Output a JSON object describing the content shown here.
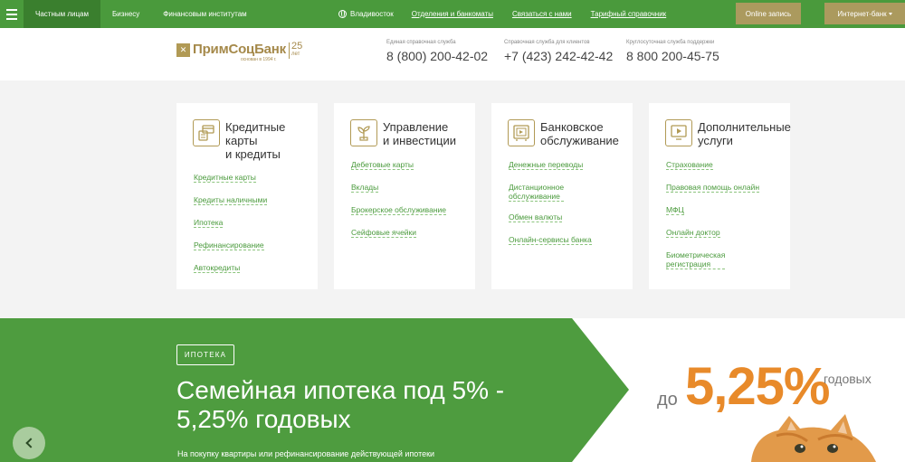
{
  "topbar": {
    "segments": [
      "Частным лицам",
      "Бизнесу",
      "Финансовым институтам"
    ],
    "city": "Владивосток",
    "links": [
      "Отделения и банкоматы",
      "Связаться с нами",
      "Тарифный справочник"
    ],
    "online_button": "Online запись",
    "bank_button": "Интернет-банк"
  },
  "header": {
    "logo": {
      "name": "ПримСоцБанк",
      "sub": "основан в 1994 г.",
      "years": "25",
      "years_word": "лет"
    },
    "phones": [
      {
        "caption": "Единая справочная служба",
        "number": "8 (800) 200-42-02"
      },
      {
        "caption": "Справочная служба для клиентов",
        "number": "+7 (423) 242-42-42"
      },
      {
        "caption": "Круглосуточная служба поддержки",
        "number": "8 800 200-45-75"
      }
    ]
  },
  "cards": [
    {
      "icon": "credit-card-icon",
      "title": [
        "Кредитные",
        "карты",
        "и кредиты"
      ],
      "links": [
        "Кредитные карты",
        "Кредиты наличными",
        "Ипотека",
        "Рефинансирование",
        "Автокредиты"
      ]
    },
    {
      "icon": "plant-icon",
      "title": [
        "Управление",
        "и инвестиции"
      ],
      "links": [
        "Дебетовые карты",
        "Вклады",
        "Брокерское обслуживание",
        "Сейфовые ячейки"
      ]
    },
    {
      "icon": "safe-icon",
      "title": [
        "Банковское",
        "обслуживание"
      ],
      "links": [
        [
          "Денежные переводы"
        ],
        [
          "Дистанционное",
          "обслуживание"
        ],
        [
          "Обмен валюты"
        ],
        [
          "Онлайн-сервисы банка"
        ]
      ]
    },
    {
      "icon": "monitor-icon",
      "title": [
        "Дополнительные",
        "услуги"
      ],
      "links": [
        [
          "Страхование"
        ],
        [
          "Правовая помощь онлайн"
        ],
        [
          "МФЦ"
        ],
        [
          "Онлайн доктор"
        ],
        [
          "Биометрическая",
          "регистрация"
        ]
      ]
    }
  ],
  "banner": {
    "tag": "ИПОТЕКА",
    "headline_line1": "Семейная ипотека под 5% -",
    "headline_line2": "5,25% годовых",
    "subtext": "На покупку квартиры или рефинансирование действующей ипотеки",
    "promo_prefix": "до",
    "promo_rate": "5,25%",
    "promo_suffix": "годовых"
  },
  "colors": {
    "green": "#4a9a3c",
    "gold": "#ab9a5e",
    "orange": "#e88a2a"
  }
}
